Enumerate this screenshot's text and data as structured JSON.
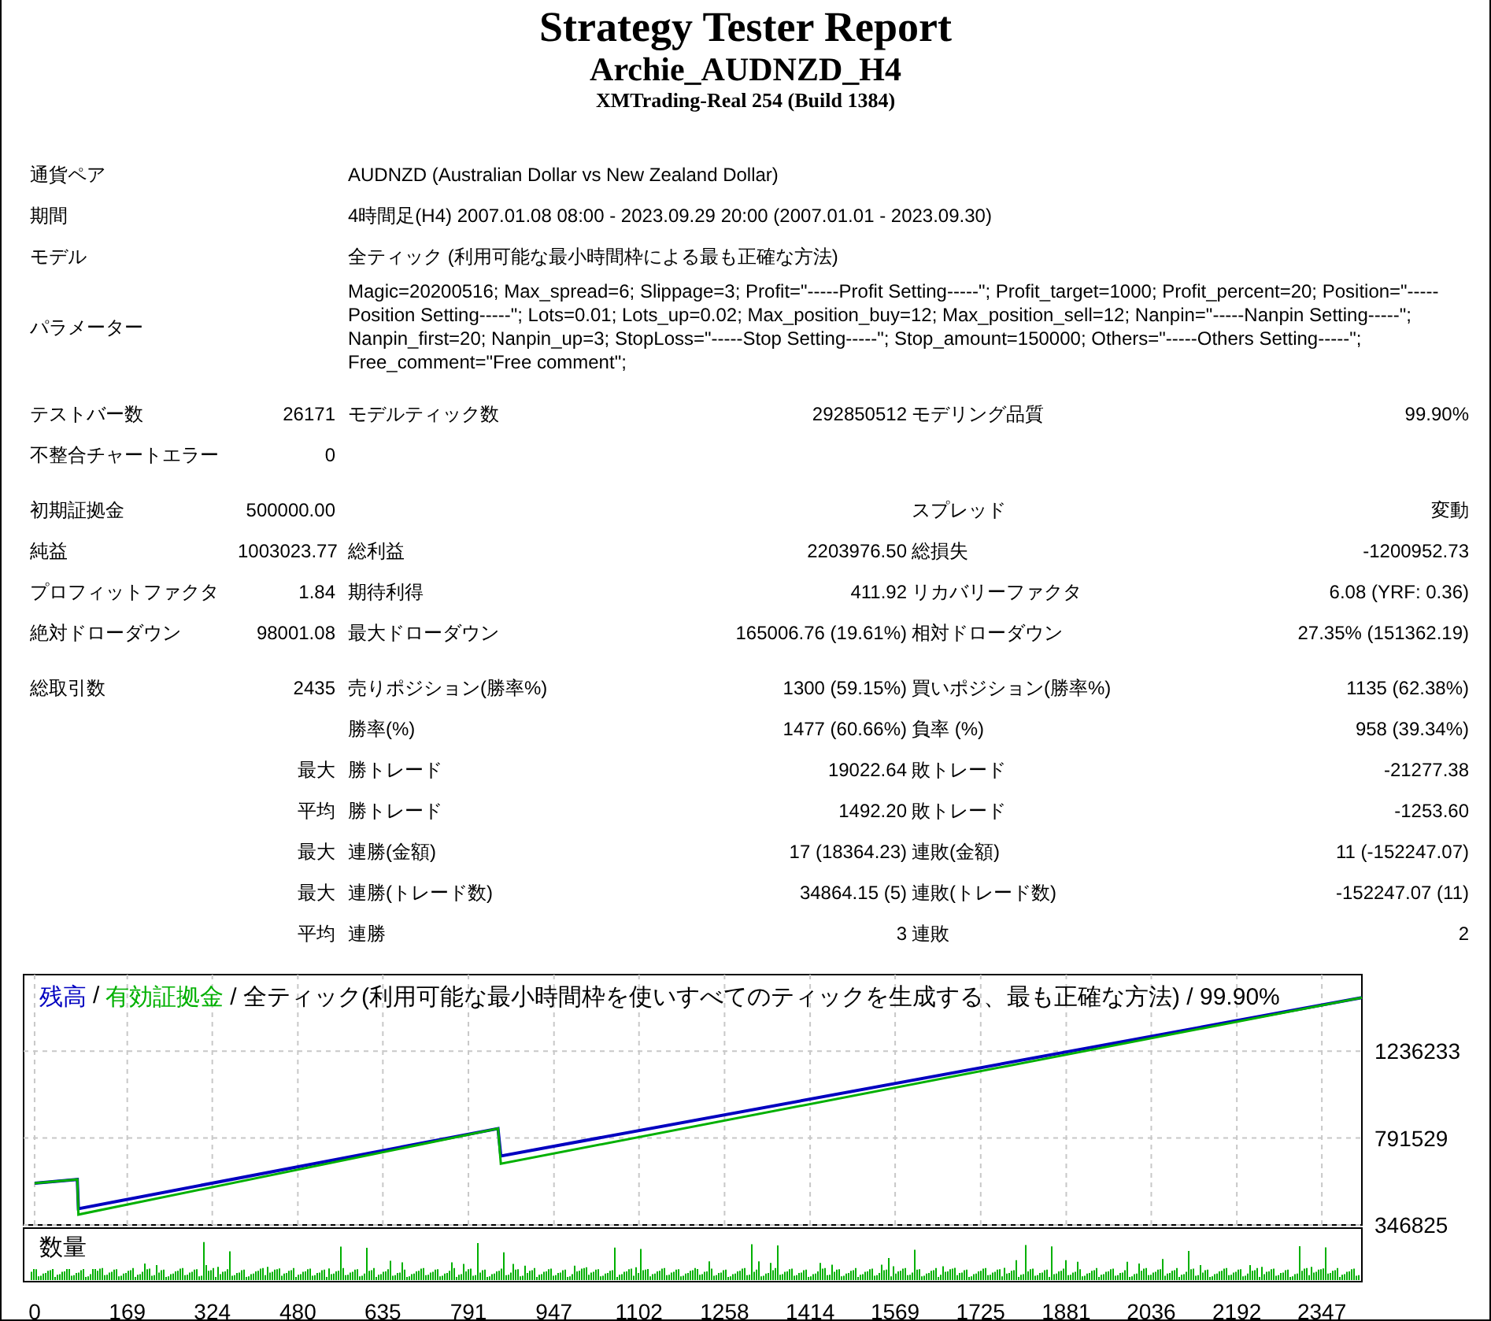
{
  "header": {
    "title": "Strategy Tester Report",
    "subtitle": "Archie_AUDNZD_H4",
    "server": "XMTrading-Real 254 (Build 1384)"
  },
  "info": [
    {
      "label": "通貨ペア",
      "value": "AUDNZD (Australian Dollar vs New Zealand Dollar)"
    },
    {
      "label": "期間",
      "value": "4時間足(H4) 2007.01.08 08:00 - 2023.09.29 20:00 (2007.01.01 - 2023.09.30)"
    },
    {
      "label": "モデル",
      "value": "全ティック (利用可能な最小時間枠による最も正確な方法)"
    },
    {
      "label": "パラメーター",
      "value": "Magic=20200516; Max_spread=6; Slippage=3; Profit=\"-----Profit Setting-----\"; Profit_target=1000; Profit_percent=20; Position=\"-----Position Setting-----\"; Lots=0.01; Lots_up=0.02; Max_position_buy=12; Max_position_sell=12; Nanpin=\"-----Nanpin Setting-----\"; Nanpin_first=20; Nanpin_up=3; StopLoss=\"-----Stop Setting-----\"; Stop_amount=150000; Others=\"-----Others Setting-----\"; Free_comment=\"Free comment\";"
    }
  ],
  "stat_groups": [
    [
      {
        "label_1": "テストバー数",
        "value_1": "26171",
        "label_2": "モデルティック数",
        "value_2": "292850512",
        "label_3": "モデリング品質",
        "value_3": "99.90%"
      },
      {
        "label_1": "不整合チャートエラー",
        "value_1": "0"
      }
    ],
    [
      {
        "label_1": "初期証拠金",
        "value_1": "500000.00",
        "label_3": "スプレッド",
        "value_3": "変動"
      },
      {
        "label_1": "純益",
        "value_1": "1003023.77",
        "label_2": "総利益",
        "value_2": "2203976.50",
        "label_3": "総損失",
        "value_3": "-1200952.73"
      },
      {
        "label_1": "プロフィットファクタ",
        "value_1": "1.84",
        "label_2": "期待利得",
        "value_2": "411.92",
        "label_3": "リカバリーファクタ",
        "value_3": "6.08 (YRF: 0.36)"
      },
      {
        "label_1": "絶対ドローダウン",
        "value_1": "98001.08",
        "label_2": "最大ドローダウン",
        "value_2": "165006.76 (19.61%)",
        "label_3": "相対ドローダウン",
        "value_3": "27.35% (151362.19)"
      }
    ],
    [
      {
        "label_1": "総取引数",
        "value_1": "2435",
        "label_2": "売りポジション(勝率%)",
        "value_2": "1300 (59.15%)",
        "label_3": "買いポジション(勝率%)",
        "value_3": "1135 (62.38%)"
      },
      {
        "label_2": "勝率(%)",
        "value_2": "1477 (60.66%)",
        "label_3": "負率 (%)",
        "value_3": "958 (39.34%)"
      },
      {
        "value_1": "最大",
        "label_2": "勝トレード",
        "value_2": "19022.64",
        "label_3": "敗トレード",
        "value_3": "-21277.38"
      },
      {
        "value_1": "平均",
        "label_2": "勝トレード",
        "value_2": "1492.20",
        "label_3": "敗トレード",
        "value_3": "-1253.60"
      },
      {
        "value_1": "最大",
        "label_2": "連勝(金額)",
        "value_2": "17 (18364.23)",
        "label_3": "連敗(金額)",
        "value_3": "11 (-152247.07)"
      },
      {
        "value_1": "最大",
        "label_2": "連勝(トレード数)",
        "value_2": "34864.15 (5)",
        "label_3": "連敗(トレード数)",
        "value_3": "-152247.07 (11)"
      },
      {
        "value_1": "平均",
        "label_2": "連勝",
        "value_2": "3",
        "label_3": "連敗",
        "value_3": "2"
      }
    ]
  ],
  "graph": {
    "legend_separator": "/",
    "legend_note": "/ 全ティック(利用可能な最小時間枠を使いすべてのティックを生成する、最も正確な方法) / 99.90%",
    "volume_label": "数量",
    "chart_data": {
      "type": "line",
      "x": [
        0,
        78,
        80,
        845,
        850,
        2420
      ],
      "series": [
        {
          "name": "残高",
          "color": "#0000c0",
          "values": [
            560000,
            580000,
            430000,
            840000,
            700000,
            1510000
          ]
        },
        {
          "name": "有効証拠金",
          "color": "#00b000",
          "values": [
            560000,
            580000,
            400000,
            840000,
            660000,
            1510000
          ]
        }
      ],
      "grid": true,
      "xlim": [
        -20,
        2420
      ],
      "ylim": [
        346825,
        1628000
      ],
      "xticks": [
        0,
        169,
        324,
        480,
        635,
        791,
        947,
        1102,
        1258,
        1414,
        1569,
        1725,
        1881,
        2036,
        2192,
        2347
      ],
      "yticks": [
        346825,
        791529,
        1236233
      ]
    }
  }
}
